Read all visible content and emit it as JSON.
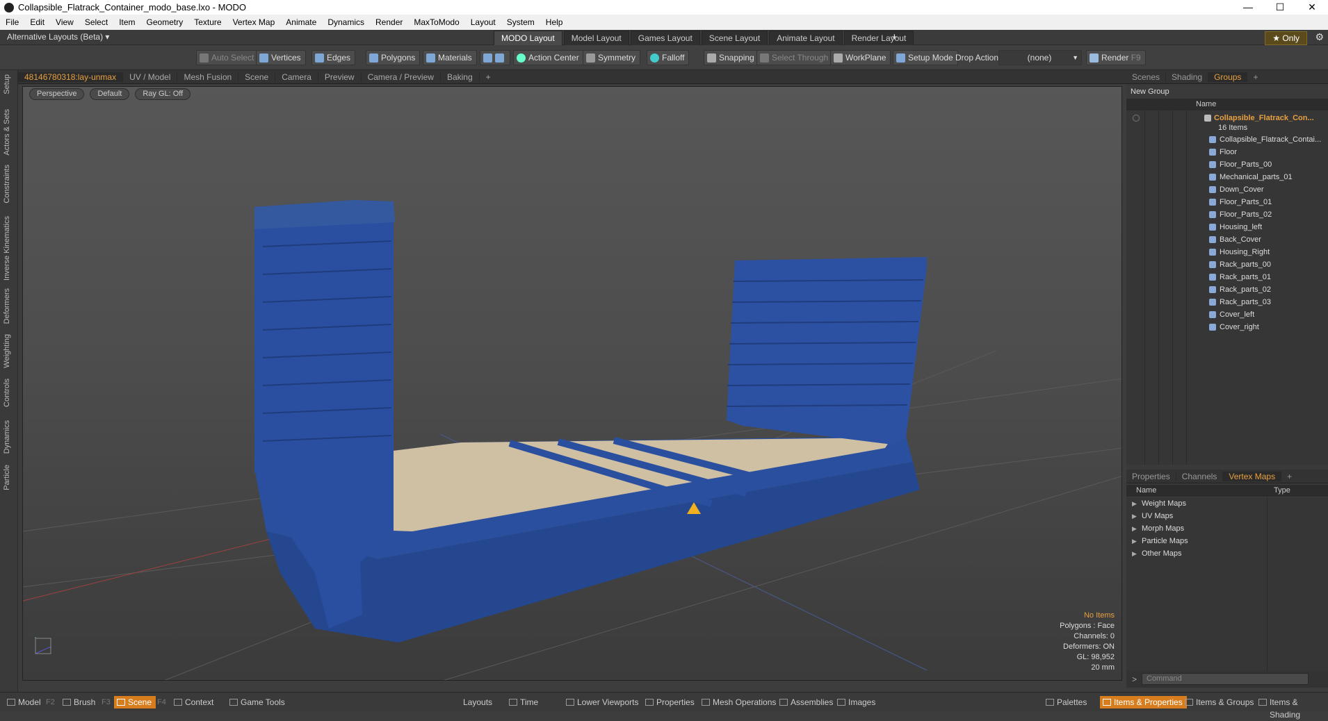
{
  "window": {
    "title": "Collapsible_Flatrack_Container_modo_base.lxo - MODO",
    "controls": [
      "—",
      "☐",
      "✕"
    ]
  },
  "menu": [
    "File",
    "Edit",
    "View",
    "Select",
    "Item",
    "Geometry",
    "Texture",
    "Vertex Map",
    "Animate",
    "Dynamics",
    "Render",
    "MaxToModo",
    "Layout",
    "System",
    "Help"
  ],
  "layouts": {
    "dropdown": "Alternative Layouts (Beta)",
    "tabs": [
      "MODO Layout",
      "Model Layout",
      "Games Layout",
      "Scene Layout",
      "Animate Layout",
      "Render Layout"
    ],
    "active": "MODO Layout",
    "plus": "+",
    "only": "★ Only"
  },
  "toolbar": {
    "auto_select": "Auto Select",
    "vertices": "Vertices",
    "edges": "Edges",
    "polygons": "Polygons",
    "materials": "Materials",
    "action_center": "Action Center",
    "symmetry": "Symmetry",
    "falloff": "Falloff",
    "snapping": "Snapping",
    "select_through": "Select Through",
    "workplane": "WorkPlane",
    "setup_mode": "Setup Mode",
    "drop_action": "Drop Action",
    "drop_value": "(none)",
    "render": "Render",
    "render_key": "F9"
  },
  "left_tabs": [
    "Setup",
    "Actors & Sets",
    "Constraints",
    "Inverse Kinematics",
    "Deformers",
    "Weighting",
    "Controls",
    "Dynamics",
    "Particle"
  ],
  "viewport": {
    "tabs": [
      "48146780318:lay-unmax",
      "UV / Model",
      "Mesh Fusion",
      "Scene",
      "Camera",
      "Preview",
      "Camera / Preview",
      "Baking"
    ],
    "active_tab": "48146780318:lay-unmax",
    "tab_plus": "+",
    "view": "Perspective",
    "shading": "Default",
    "raygl": "Ray GL: Off",
    "info": {
      "items": "No Items",
      "polygons": "Polygons : Face",
      "channels": "Channels: 0",
      "deformers": "Deformers: ON",
      "gl": "GL: 98,952",
      "scale": "20 mm"
    }
  },
  "scene_panel": {
    "tabs": [
      "Scenes",
      "Shading",
      "Groups"
    ],
    "active": "Groups",
    "plus": "+",
    "new_group": "New Group",
    "col_name": "Name",
    "group_name": "Collapsible_Flatrack_Con...",
    "group_count": "16 Items",
    "items": [
      "Collapsible_Flatrack_Contai...",
      "Floor",
      "Floor_Parts_00",
      "Mechanical_parts_01",
      "Down_Cover",
      "Floor_Parts_01",
      "Floor_Parts_02",
      "Housing_left",
      "Back_Cover",
      "Housing_Right",
      "Rack_parts_00",
      "Rack_parts_01",
      "Rack_parts_02",
      "Rack_parts_03",
      "Cover_left",
      "Cover_right"
    ]
  },
  "props_panel": {
    "tabs": [
      "Properties",
      "Channels",
      "Vertex Maps"
    ],
    "active": "Vertex Maps",
    "plus": "+",
    "col_name": "Name",
    "col_type": "Type",
    "maps": [
      "Weight Maps",
      "UV Maps",
      "Morph Maps",
      "Particle Maps",
      "Other Maps"
    ]
  },
  "command": {
    "prompt": ">",
    "placeholder": "Command"
  },
  "bottom": {
    "left": [
      {
        "label": "Model",
        "key": "F2"
      },
      {
        "label": "Brush",
        "key": "F3"
      },
      {
        "label": "Scene",
        "key": "F4"
      },
      {
        "label": "Context",
        "key": ""
      },
      {
        "label": "Game Tools",
        "key": ""
      }
    ],
    "active": "Scene",
    "center": [
      "Layouts",
      "Time",
      "Lower Viewports",
      "Properties",
      "Mesh Operations",
      "Assemblies",
      "Images"
    ],
    "right": [
      "Palettes",
      "Items & Properties",
      "Items & Groups",
      "Items & Shading"
    ],
    "right_active": "Items & Properties"
  },
  "colors": {
    "accent": "#e8a040",
    "active_tab": "#d77d1d",
    "container_blue": "#2b4fa0"
  }
}
